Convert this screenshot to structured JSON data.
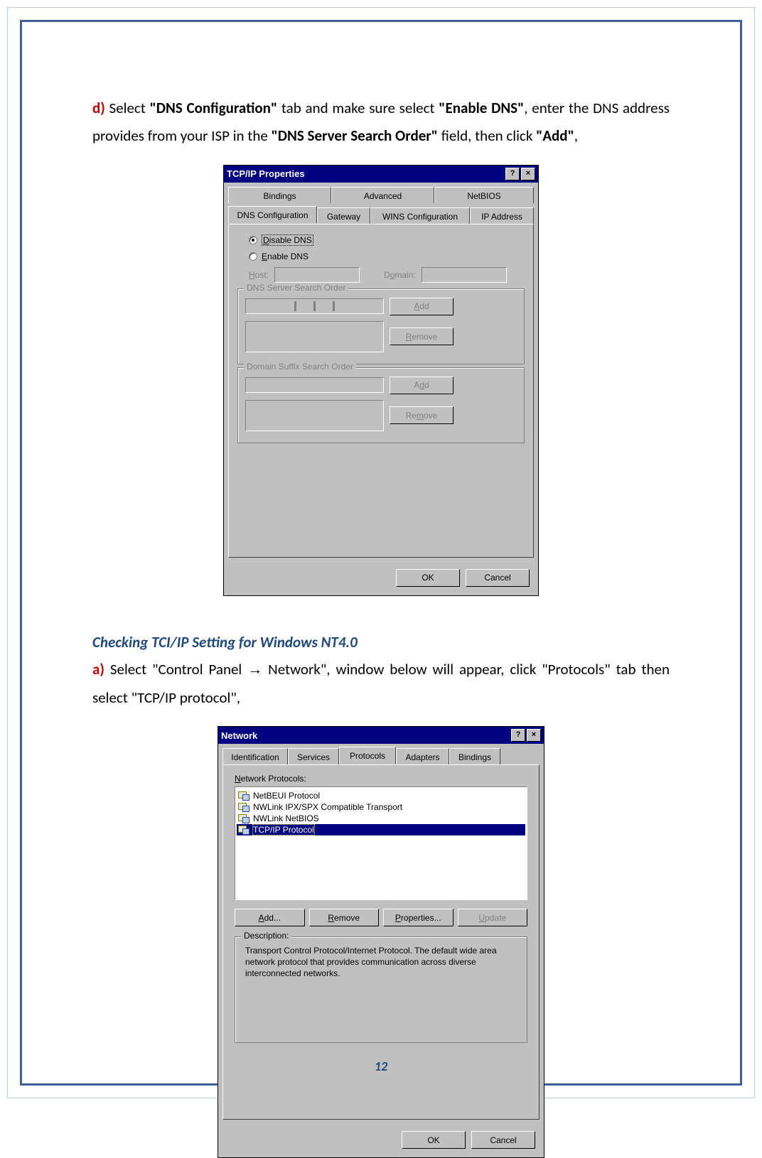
{
  "page_number": "12",
  "step_d": {
    "prefix": "d)",
    "t1": " Select ",
    "b1": "\"DNS Configuration\"",
    "t2": " tab and make sure select ",
    "b2": "\"Enable DNS\"",
    "t3": ", enter the DNS address provides from your ISP in the ",
    "b3": "\"DNS Server Search Order\"",
    "t4": " field, then click ",
    "b4": "\"Add\"",
    "t5": ","
  },
  "dialog1": {
    "title": "TCP/IP Properties",
    "help_btn": "?",
    "close_btn": "×",
    "tabs_back": [
      "Bindings",
      "Advanced",
      "NetBIOS"
    ],
    "tabs_front": [
      "DNS Configuration",
      "Gateway",
      "WINS Configuration",
      "IP Address"
    ],
    "radio_disable": "Disable DNS",
    "radio_enable": "Enable DNS",
    "host_label": "Host:",
    "domain_label": "Domain:",
    "group_dns": "DNS Server Search Order",
    "group_domain": "Domain Suffix Search Order",
    "btn_add": "Add",
    "btn_remove": "Remove",
    "btn_ok": "OK",
    "btn_cancel": "Cancel"
  },
  "section_title": "Checking TCI/IP Setting for Windows NT4.0",
  "step_a": {
    "prefix": "a)",
    "t1": " Select \"Control Panel ",
    "arrow": "→",
    "t2": " Network\", window below will appear, click \"Protocols\" tab then select \"TCP/IP protocol\","
  },
  "dialog2": {
    "title": "Network",
    "help_btn": "?",
    "close_btn": "×",
    "tabs": [
      "Identification",
      "Services",
      "Protocols",
      "Adapters",
      "Bindings"
    ],
    "list_label": "Network Protocols:",
    "protocols": [
      "NetBEUI Protocol",
      "NWLink IPX/SPX Compatible Transport",
      "NWLink NetBIOS",
      "TCP/IP Protocol"
    ],
    "btn_add": "Add...",
    "btn_remove": "Remove",
    "btn_properties": "Properties...",
    "btn_update": "Update",
    "desc_label": "Description:",
    "desc_text": "Transport Control Protocol/Internet Protocol. The default wide area network protocol that provides communication across diverse interconnected networks.",
    "btn_ok": "OK",
    "btn_cancel": "Cancel"
  }
}
